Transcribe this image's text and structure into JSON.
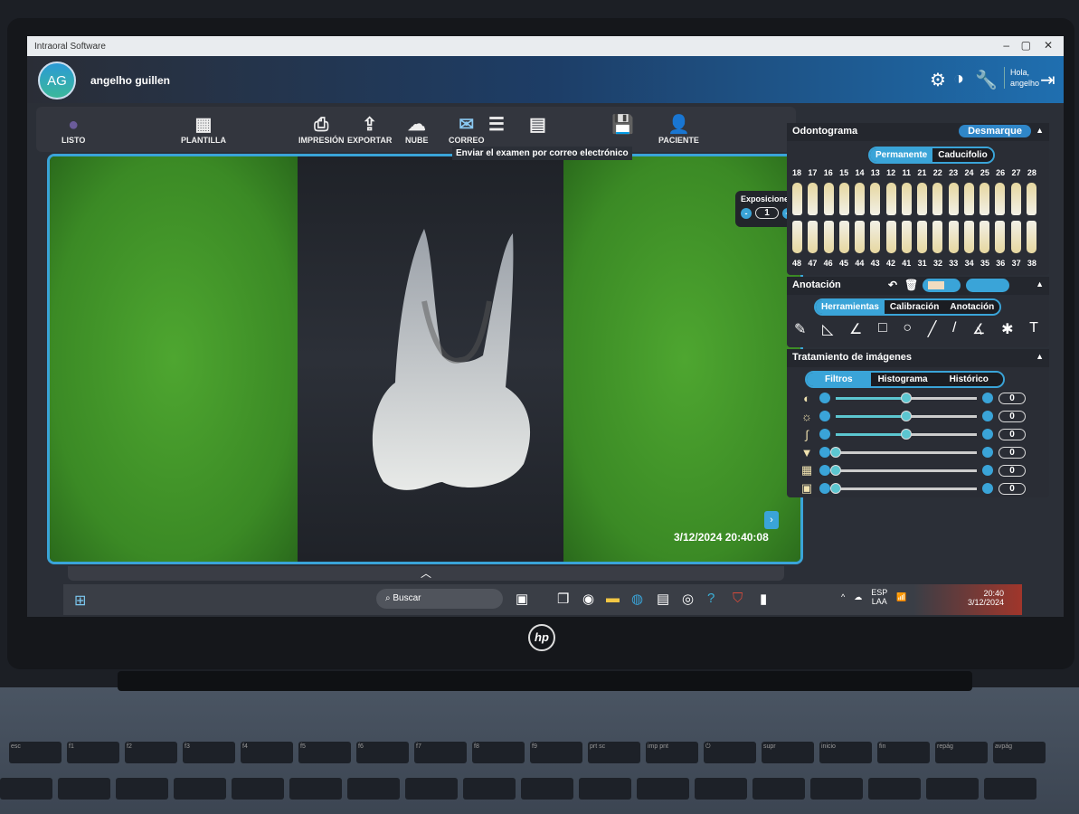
{
  "window": {
    "title": "Intraoral Software",
    "controls": [
      "–",
      "▢",
      "✕"
    ]
  },
  "header": {
    "avatar_initials": "AG",
    "user_name": "angelho guillen",
    "greeting": "Hola, angelho",
    "icons": [
      "gear-icon",
      "brightness-icon",
      "wrench-icon",
      "logout-icon"
    ]
  },
  "toolbar": {
    "items": [
      {
        "label": "LISTO",
        "icon": "●"
      },
      {
        "label": "PLANTILLA",
        "icon": "▦"
      },
      {
        "label": "IMPRESIÓN",
        "icon": "⎙"
      },
      {
        "label": "EXPORTAR",
        "icon": "⇪"
      },
      {
        "label": "NUBE",
        "icon": "☁"
      },
      {
        "label": "CORREO",
        "icon": "✉"
      },
      {
        "label": "",
        "icon": "☰"
      },
      {
        "label": "",
        "icon": "▤"
      },
      {
        "label": "",
        "icon": "💾"
      },
      {
        "label": "PACIENTE",
        "icon": "👤"
      }
    ],
    "tooltip": "Enviar el examen por correo electrónico"
  },
  "viewer": {
    "exposiciones_label": "Exposiciones",
    "exposure_value": "1",
    "timestamp": "3/12/2024 20:40:08",
    "collapse": "︿",
    "next": "›"
  },
  "odontograma": {
    "title": "Odontograma",
    "unmark": "Desmarque",
    "tabs": [
      "Permanente",
      "Caducifolio"
    ],
    "upper": [
      "18",
      "17",
      "16",
      "15",
      "14",
      "13",
      "12",
      "11",
      "21",
      "22",
      "23",
      "24",
      "25",
      "26",
      "27",
      "28"
    ],
    "lower": [
      "48",
      "47",
      "46",
      "45",
      "44",
      "43",
      "42",
      "41",
      "31",
      "32",
      "33",
      "34",
      "35",
      "36",
      "37",
      "38"
    ]
  },
  "anotacion": {
    "title": "Anotación",
    "tabs": [
      "Herramientas",
      "Calibración",
      "Anotación"
    ],
    "tools": [
      "✎",
      "◺",
      "∠",
      "□",
      "○",
      "╱",
      "/",
      "∡",
      "✱",
      "T"
    ]
  },
  "tratamiento": {
    "title": "Tratamiento de imágenes",
    "tabs": [
      "Filtros",
      "Histograma",
      "Histórico"
    ],
    "sliders": [
      {
        "icon": "◐",
        "name": "contrast",
        "value": "0",
        "level": 0.5
      },
      {
        "icon": "☼",
        "name": "brightness",
        "value": "0",
        "level": 0.5
      },
      {
        "icon": "∫",
        "name": "gamma",
        "value": "0",
        "level": 0.5
      },
      {
        "icon": "▼",
        "name": "sharpen",
        "value": "0",
        "level": 0
      },
      {
        "icon": "▦",
        "name": "noise",
        "value": "0",
        "level": 0
      },
      {
        "icon": "▣",
        "name": "edge",
        "value": "0",
        "level": 0
      }
    ]
  },
  "taskbar": {
    "search": "Buscar",
    "lang": "ESP",
    "layout": "LAA",
    "time": "20:40",
    "date": "3/12/2024"
  },
  "brand": "hp",
  "keys": [
    "esc",
    "f1",
    "f2",
    "f3",
    "f4",
    "f5",
    "f6",
    "f7",
    "f8",
    "f9",
    "prt sc",
    "imp pnt",
    "⏻",
    "supr",
    "inicio",
    "fin",
    "repág",
    "avpág"
  ]
}
